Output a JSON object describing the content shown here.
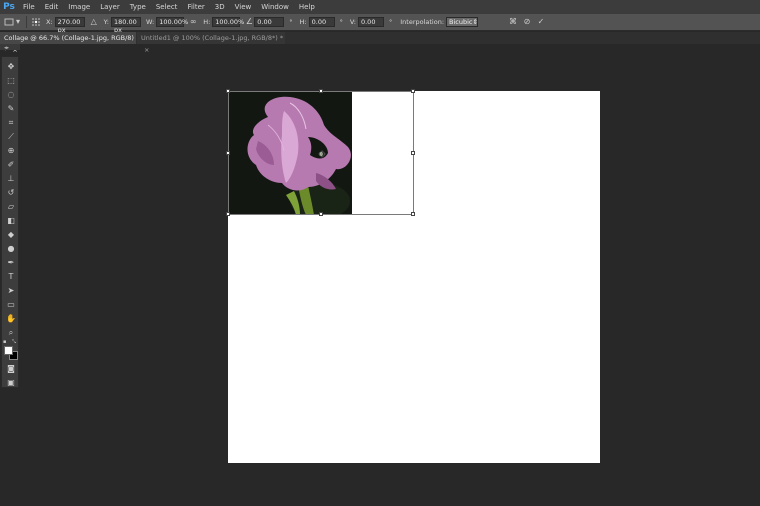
{
  "app": {
    "logo": "Ps"
  },
  "menu": [
    "File",
    "Edit",
    "Image",
    "Layer",
    "Type",
    "Select",
    "Filter",
    "3D",
    "View",
    "Window",
    "Help"
  ],
  "options": {
    "x_label": "X:",
    "x_value": "270.00 px",
    "y_label": "Y:",
    "y_value": "180.00 px",
    "w_label": "W:",
    "w_value": "100.00%",
    "h_label": "H:",
    "h_value": "100.00%",
    "angle_value": "0.00",
    "angle_unit": "°",
    "hskew_label": "H:",
    "hskew_value": "0.00",
    "hskew_unit": "°",
    "vskew_label": "V:",
    "vskew_value": "0.00",
    "vskew_unit": "°",
    "interp_label": "Interpolation:",
    "interp_value": "Bicubic"
  },
  "tabs": [
    {
      "label": "Collage @ 66.7% (Collage-1.jpg, RGB/8) *",
      "close": "×"
    },
    {
      "label": "Untitled1 @ 100% (Collage-1.jpg, RGB/8*) *",
      "close": "×"
    }
  ],
  "colors": {
    "foreground": "#ffffff",
    "background": "#000000",
    "flower": "#b77ab0"
  },
  "tools": [
    "move-icon",
    "marquee-icon",
    "lasso-icon",
    "quick-select-icon",
    "crop-icon",
    "eyedropper-icon",
    "healing-icon",
    "brush-icon",
    "stamp-icon",
    "history-brush-icon",
    "eraser-icon",
    "gradient-icon",
    "blur-icon",
    "dodge-icon",
    "pen-icon",
    "type-icon",
    "path-select-icon",
    "shape-icon",
    "hand-icon",
    "zoom-icon"
  ]
}
